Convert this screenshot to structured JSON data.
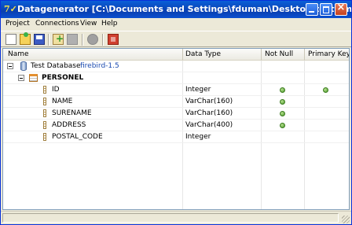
{
  "window": {
    "title": "Datagenerator [C:\\Documents and Settings\\fduman\\Desktop\\test.xml]",
    "app_icon": "7✓"
  },
  "menu": {
    "items": [
      {
        "label": "Project"
      },
      {
        "label": "Connections"
      },
      {
        "label": "View"
      },
      {
        "label": "Help"
      }
    ]
  },
  "toolbar": {
    "icons": [
      "new-document-icon",
      "open-icon",
      "save-icon",
      "add-icon",
      "remove-icon",
      "run-icon",
      "stop-icon"
    ]
  },
  "grid": {
    "columns": [
      {
        "label": "Name"
      },
      {
        "label": "Data Type"
      },
      {
        "label": "Not Null"
      },
      {
        "label": "Primary Key"
      }
    ],
    "database": {
      "name": "Test Database",
      "version": "firebird-1.5"
    },
    "table": {
      "name": "PERSONEL"
    },
    "fields": [
      {
        "name": "ID",
        "type": "Integer",
        "not_null": true,
        "primary_key": true
      },
      {
        "name": "NAME",
        "type": "VarChar(160)",
        "not_null": true,
        "primary_key": false
      },
      {
        "name": "SURENAME",
        "type": "VarChar(160)",
        "not_null": true,
        "primary_key": false
      },
      {
        "name": "ADDRESS",
        "type": "VarChar(400)",
        "not_null": true,
        "primary_key": false
      },
      {
        "name": "POSTAL_CODE",
        "type": "Integer",
        "not_null": false,
        "primary_key": false
      }
    ]
  },
  "statusbar": {
    "text": ""
  }
}
